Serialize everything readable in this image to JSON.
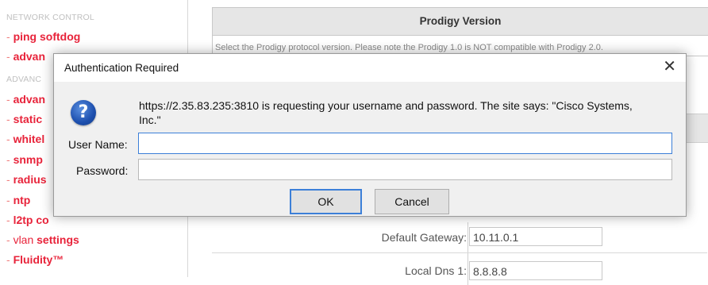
{
  "sidebar": {
    "section_network": "NETWORK CONTROL",
    "section_advanced": "ADVANC",
    "items": [
      {
        "dash": "- ",
        "prefix": "",
        "label": "ping softdog"
      },
      {
        "dash": "- ",
        "prefix": "",
        "label": "advan"
      },
      {
        "dash": "- ",
        "prefix": "",
        "label": "advan"
      },
      {
        "dash": "- ",
        "prefix": "",
        "label": "static"
      },
      {
        "dash": "- ",
        "prefix": "",
        "label": "whitel"
      },
      {
        "dash": "- ",
        "prefix": "",
        "label": "snmp"
      },
      {
        "dash": "- ",
        "prefix": "",
        "label": "radius"
      },
      {
        "dash": "- ",
        "prefix": "",
        "label": "ntp"
      },
      {
        "dash": "- ",
        "prefix": "",
        "label": "l2tp co"
      },
      {
        "dash": "- ",
        "prefix": "vlan ",
        "label": "settings"
      },
      {
        "dash": "- ",
        "prefix": "",
        "label": "Fluidity™"
      }
    ]
  },
  "content": {
    "prodigy_title": "Prodigy Version",
    "prodigy_desc": "Select the Prodigy protocol version. Please note the Prodigy 1.0 is NOT compatible with Prodigy 2.0.",
    "default_gateway_label": "Default Gateway:",
    "default_gateway_value": "10.11.0.1",
    "local_dns_label": "Local Dns 1:",
    "local_dns_value": "8.8.8.8"
  },
  "dialog": {
    "title": "Authentication Required",
    "close_glyph": "✕",
    "icon_glyph": "?",
    "message": "https://2.35.83.235:3810 is requesting your username and password. The site says: \"Cisco Systems, Inc.\"",
    "username_label": "User Name:",
    "username_value": "",
    "password_label": "Password:",
    "password_value": "",
    "ok_label": "OK",
    "cancel_label": "Cancel"
  },
  "colors": {
    "accent": "#3c7fd8",
    "link_red": "#e8233a",
    "dialog_bg": "#f0f0f0"
  }
}
